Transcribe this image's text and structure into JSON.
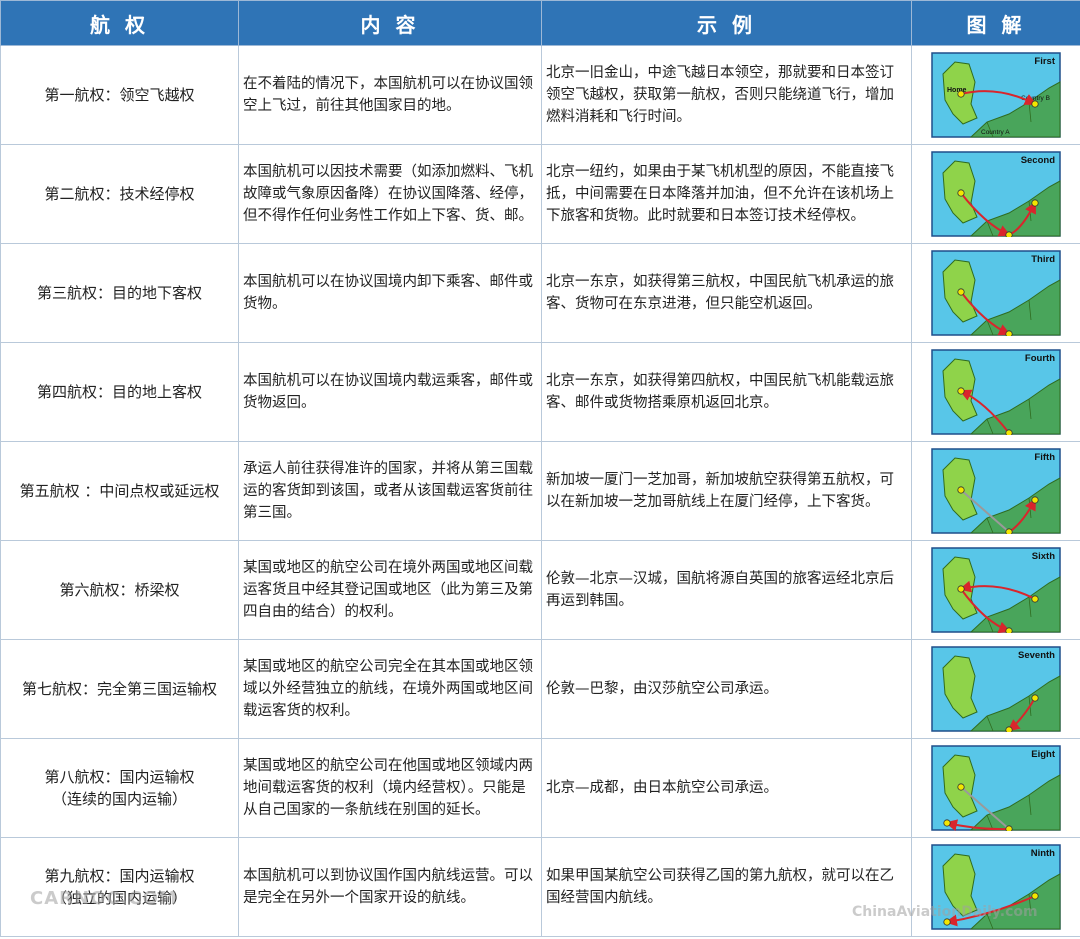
{
  "headers": [
    "航 权",
    "内 容",
    "示 例",
    "图 解"
  ],
  "rows": [
    {
      "name": [
        "第一航权：领空飞越权"
      ],
      "content": "在不着陆的情况下，本国航机可以在协议国领空上飞过，前往其他国家目的地。",
      "example": "北京一旧金山，中途飞越日本领空，那就要和日本签订领空飞越权，获取第一航权，否则只能绕道飞行，增加燃料消耗和飞行时间。",
      "diagram": {
        "label": "First",
        "home_label": "Home",
        "country_a": "Country A",
        "country_b": "Country B"
      }
    },
    {
      "name": [
        "第二航权：技术经停权"
      ],
      "content": "本国航机可以因技术需要（如添加燃料、飞机故障或气象原因备降）在协议国降落、经停，但不得作任何业务性工作如上下客、货、邮。",
      "example": "北京一纽约，如果由于某飞机机型的原因，不能直接飞抵，中间需要在日本降落并加油，但不允许在该机场上下旅客和货物。此时就要和日本签订技术经停权。",
      "diagram": {
        "label": "Second"
      }
    },
    {
      "name": [
        "第三航权：目的地下客权"
      ],
      "content": "本国航机可以在协议国境内卸下乘客、邮件或货物。",
      "example": "北京一东京，如获得第三航权，中国民航飞机承运的旅客、货物可在东京进港，但只能空机返回。",
      "diagram": {
        "label": "Third"
      }
    },
    {
      "name": [
        "第四航权：目的地上客权"
      ],
      "content": "本国航机可以在协议国境内载运乘客，邮件或货物返回。",
      "example": "北京一东京，如获得第四航权，中国民航飞机能载运旅客、邮件或货物搭乘原机返回北京。",
      "diagram": {
        "label": "Fourth"
      }
    },
    {
      "name": [
        "第五航权 ：中间点权或延远权"
      ],
      "content": "承运人前往获得准许的国家，并将从第三国载运的客货卸到该国，或者从该国载运客货前往第三国。",
      "example": "新加坡一厦门一芝加哥，新加坡航空获得第五航权，可以在新加坡一芝加哥航线上在厦门经停，上下客货。",
      "diagram": {
        "label": "Fifth"
      }
    },
    {
      "name": [
        "第六航权：桥梁权"
      ],
      "content": "某国或地区的航空公司在境外两国或地区间载运客货且中经其登记国或地区（此为第三及第四自由的结合）的权利。",
      "example": "伦敦—北京—汉城，国航将源自英国的旅客运经北京后再运到韩国。",
      "diagram": {
        "label": "Sixth"
      }
    },
    {
      "name": [
        "第七航权：完全第三国运输权"
      ],
      "content": "某国或地区的航空公司完全在其本国或地区领域以外经营独立的航线，在境外两国或地区间载运客货的权利。",
      "example": "伦敦—巴黎，由汉莎航空公司承运。",
      "diagram": {
        "label": "Seventh"
      }
    },
    {
      "name": [
        "第八航权：国内运输权",
        "（连续的国内运输）"
      ],
      "content": "某国或地区的航空公司在他国或地区领域内两地间载运客货的权利（境内经营权）。只能是从自己国家的一条航线在别国的延长。",
      "example": "北京—成都，由日本航空公司承运。",
      "diagram": {
        "label": "Eight"
      }
    },
    {
      "name": [
        "第九航权：国内运输权",
        "（独立的国内运输）"
      ],
      "content": "本国航机可以到协议国作国内航线运营。可以是完全在另外一个国家开设的航线。",
      "example": "如果甲国某航空公司获得乙国的第九航权，就可以在乙国经营国内航线。",
      "diagram": {
        "label": "Ninth"
      }
    }
  ],
  "watermarks": {
    "left": "CARNOC.COM",
    "right": "ChinaAviationDaily.com"
  },
  "colors": {
    "header_bg": "#2f74b6",
    "water": "#58c6e8",
    "land": "#8fd34a",
    "coast": "#49a55b",
    "route": "#d9252c",
    "airport": "#f3e600"
  }
}
